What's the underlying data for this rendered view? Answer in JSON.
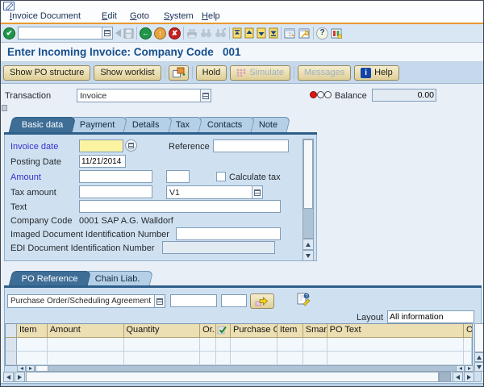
{
  "menubar": {
    "items": [
      "Invoice Document",
      "Edit",
      "Goto",
      "System",
      "Help"
    ]
  },
  "icons": {
    "enter": "✔",
    "back": "←",
    "exit": "↑",
    "cancel": "✘",
    "help_q": "?",
    "info": "i"
  },
  "toolbar": {
    "command_value": ""
  },
  "header": {
    "title": "Enter Incoming Invoice: Company Code   001"
  },
  "app_toolbar": {
    "show_po_structure": "Show PO structure",
    "show_worklist": "Show worklist",
    "hold": "Hold",
    "simulate": "Simulate",
    "messages": "Messages",
    "help": "Help"
  },
  "transaction": {
    "label": "Transaction",
    "value": "Invoice"
  },
  "balance": {
    "label": "Balance",
    "value": "0.00"
  },
  "tabs": {
    "items": [
      "Basic data",
      "Payment",
      "Details",
      "Tax",
      "Contacts",
      "Note"
    ],
    "active": "Basic data"
  },
  "form": {
    "invoice_date": {
      "label": "Invoice date",
      "value": ""
    },
    "reference": {
      "label": "Reference",
      "value": ""
    },
    "posting_date": {
      "label": "Posting Date",
      "value": "11/21/2014"
    },
    "amount": {
      "label": "Amount",
      "value": "",
      "currency": ""
    },
    "calculate_tax": {
      "label": "Calculate tax",
      "checked": false
    },
    "tax_amount": {
      "label": "Tax amount",
      "value": "",
      "tax_code": "V1"
    },
    "text": {
      "label": "Text",
      "value": ""
    },
    "company_code": {
      "label": "Company Code",
      "value": "0001 SAP A.G. Walldorf"
    },
    "imaged_doc": {
      "label": "Imaged Document Identification Number",
      "value": ""
    },
    "edi_doc": {
      "label": "EDI Document Identification Number",
      "value": ""
    }
  },
  "po_section": {
    "tabs": [
      "PO Reference",
      "Chain Liab."
    ],
    "active_tab": "PO Reference",
    "reference_type": "Purchase Order/Scheduling Agreement",
    "po_number": "",
    "po_item": "",
    "layout_label": "Layout",
    "layout_value": "All information"
  },
  "po_table": {
    "columns": [
      "",
      "Item",
      "Amount",
      "Quantity",
      "Or..",
      "",
      "Purchase O..",
      "Item",
      "Smar..",
      "PO Text",
      "O"
    ],
    "rows": [
      [
        "",
        "",
        "",
        "",
        "",
        "",
        "",
        "",
        "",
        "",
        ""
      ],
      [
        "",
        "",
        "",
        "",
        "",
        "",
        "",
        "",
        "",
        "",
        ""
      ]
    ]
  },
  "colors": {
    "required_field": "#fbf3a2",
    "active_tab": "#3e6d96",
    "table_header": "#ecdfb4",
    "accent_orange": "#e8992e",
    "title_text": "#174f8c",
    "status_red": "#e01414"
  }
}
